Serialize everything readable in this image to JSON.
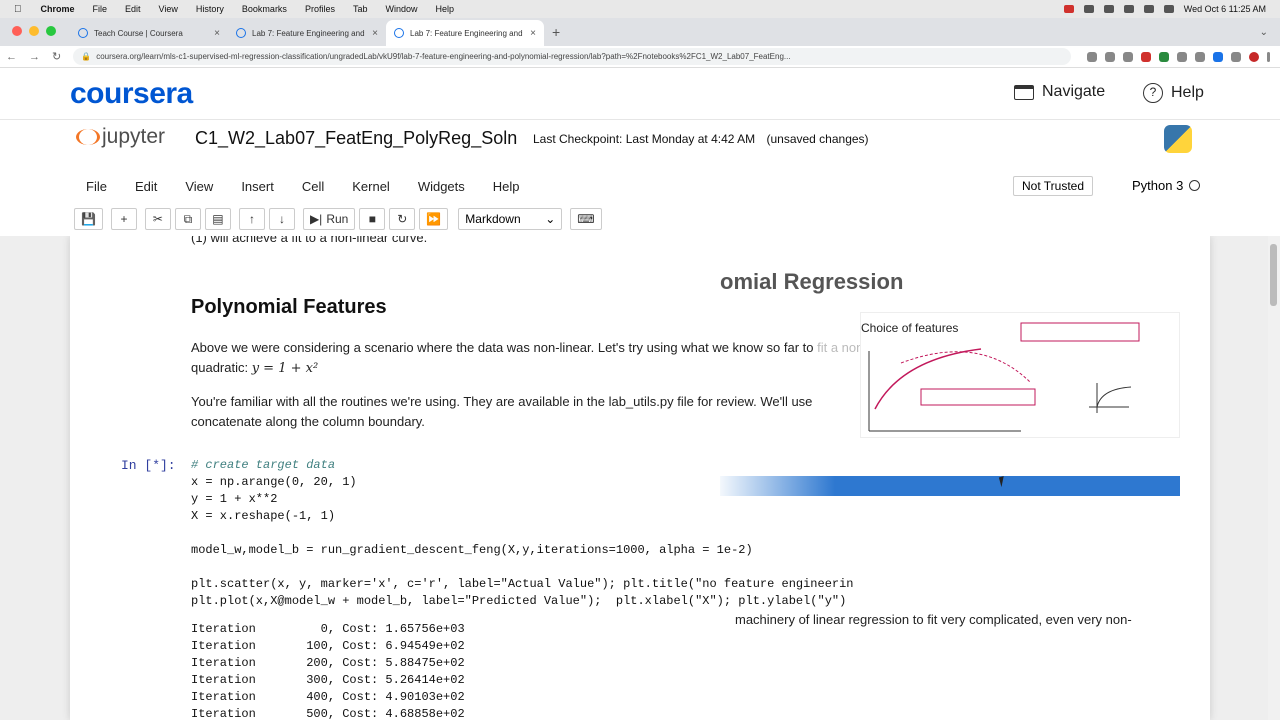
{
  "os_menubar": {
    "app": "Chrome",
    "items": [
      "File",
      "Edit",
      "View",
      "History",
      "Bookmarks",
      "Profiles",
      "Tab",
      "Window",
      "Help"
    ],
    "clock": "Wed Oct 6 11:25 AM"
  },
  "browser": {
    "tabs": [
      {
        "title": "Teach Course | Coursera"
      },
      {
        "title": "Lab 7: Feature Engineering and"
      },
      {
        "title": "Lab 7: Feature Engineering and"
      }
    ],
    "url": "coursera.org/learn/mls-c1-supervised-ml-regression-classification/ungradedLab/vkU9f/lab-7-feature-engineering-and-polynomial-regression/lab?path=%2Fnotebooks%2FC1_W2_Lab07_FeatEng..."
  },
  "coursera": {
    "logo": "coursera",
    "navigate": "Navigate",
    "help": "Help"
  },
  "jupyter": {
    "logo_text": "jupyter",
    "notebook_name": "C1_W2_Lab07_FeatEng_PolyReg_Soln",
    "checkpoint": "Last Checkpoint: Last Monday at 4:42 AM",
    "unsaved": "(unsaved changes)",
    "menu": [
      "File",
      "Edit",
      "View",
      "Insert",
      "Cell",
      "Kernel",
      "Widgets",
      "Help"
    ],
    "not_trusted": "Not Trusted",
    "kernel": "Python 3",
    "run_label": "Run",
    "cell_type": "Markdown"
  },
  "notebook": {
    "cutoff_line": "(1) will achieve a fit to a non-linear curve.",
    "overlay_title": "omial Regression",
    "section_title": "Polynomial Features",
    "para1_a": "Above we were considering a scenario where the data was non-linear. Let's try using what we know so far to",
    "para1_b": "fit a non-linear",
    "para1_c": "quadratic: ",
    "para1_eq": "y = 1 + x²",
    "para2_a": "You're familiar with all the routines we're using. They are available in the lab_utils.py file for review. We'll use",
    "para2_b": "concatenate along the column boundary.",
    "slide_heading": "Choice of features",
    "prompt": "In [*]:",
    "code_lines": [
      "# create target data",
      "x = np.arange(0, 20, 1)",
      "y = 1 + x**2",
      "X = x.reshape(-1, 1)",
      "",
      "model_w,model_b = run_gradient_descent_feng(X,y,iterations=1000, alpha = 1e-2)",
      "",
      "plt.scatter(x, y, marker='x', c='r', label=\"Actual Value\"); plt.title(\"no feature engineerin",
      "plt.plot(x,X@model_w + model_b, label=\"Predicted Value\");  plt.xlabel(\"X\"); plt.ylabel(\"y\")"
    ],
    "output_lines": [
      "Iteration         0, Cost: 1.65756e+03",
      "Iteration       100, Cost: 6.94549e+02",
      "Iteration       200, Cost: 5.88475e+02",
      "Iteration       300, Cost: 5.26414e+02",
      "Iteration       400, Cost: 4.90103e+02",
      "Iteration       500, Cost: 4.68858e+02"
    ],
    "fade_text": "machinery of linear regression to fit very complicated, even very non-"
  }
}
